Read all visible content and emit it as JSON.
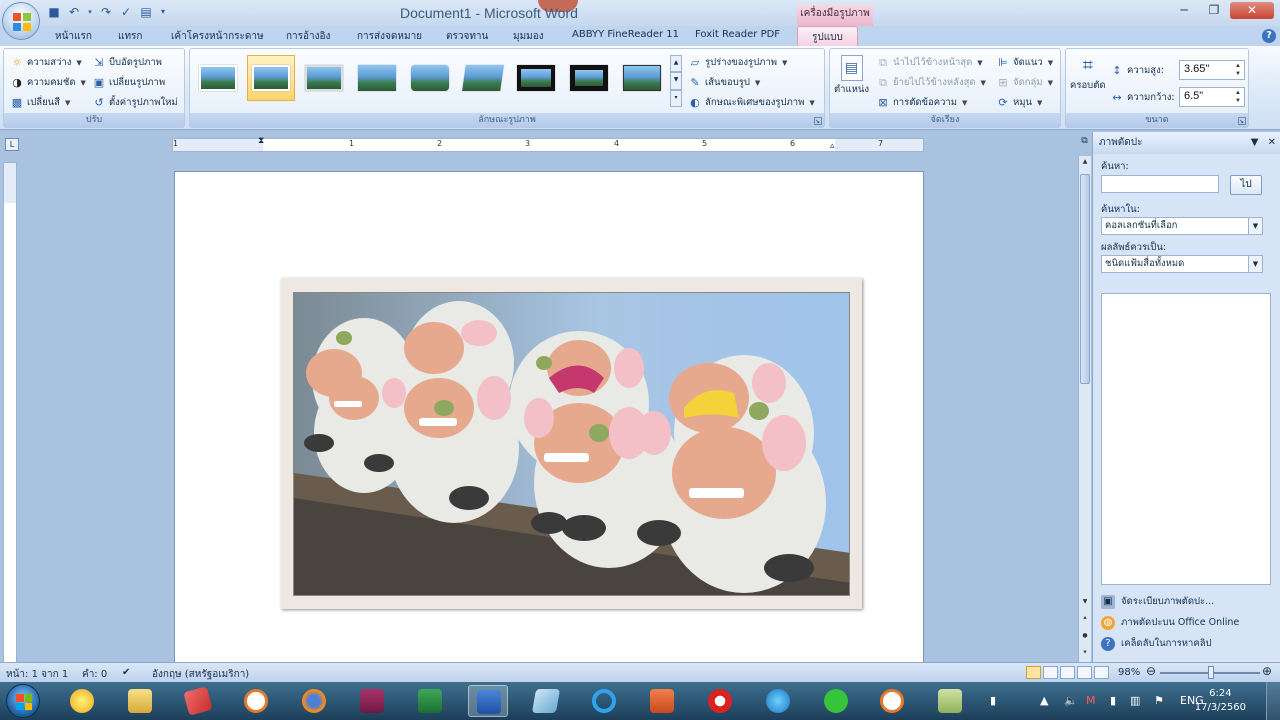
{
  "window": {
    "title": "Document1 - Microsoft Word",
    "context_tab_header": "เครื่องมือรูปภาพ",
    "minimize_label": "─",
    "restore_label": "❐",
    "close_label": "✕"
  },
  "tabs": [
    {
      "label": "หน้าแรก"
    },
    {
      "label": "แทรก"
    },
    {
      "label": "เค้าโครงหน้ากระดาษ"
    },
    {
      "label": "การอ้างอิง"
    },
    {
      "label": "การส่งจดหมาย"
    },
    {
      "label": "ตรวจทาน"
    },
    {
      "label": "มุมมอง"
    },
    {
      "label": "ABBYY FineReader 11"
    },
    {
      "label": "Foxit Reader PDF"
    },
    {
      "label": "รูปแบบ"
    }
  ],
  "ribbon": {
    "adjust": {
      "label": "ปรับ",
      "brightness": "ความสว่าง",
      "contrast": "ความคมชัด",
      "recolor": "เปลี่ยนสี",
      "compress": "บีบอัดรูปภาพ",
      "change_picture": "เปลี่ยนรูปภาพ",
      "reset_picture": "ตั้งค่ารูปภาพใหม่"
    },
    "picture_styles": {
      "label": "ลักษณะรูปภาพ",
      "shape": "รูปร่างของรูปภาพ",
      "border": "เส้นขอบรูป",
      "effects": "ลักษณะพิเศษของรูปภาพ"
    },
    "arrange": {
      "label": "จัดเรียง",
      "position": "ตำแหน่ง",
      "bring_front": "นำไปไว้ข้างหน้าสุด",
      "send_back": "ย้ายไปไว้ข้างหลังสุด",
      "text_wrap": "การตัดข้อความ",
      "align": "จัดแนว",
      "group": "จัดกลุ่ม",
      "rotate": "หมุน"
    },
    "size": {
      "label": "ขนาด",
      "crop": "ครอบตัด",
      "height_label": "ความสูง:",
      "height_value": "3.65\"",
      "width_label": "ความกว้าง:",
      "width_value": "6.5\""
    }
  },
  "ruler": {
    "numbers": [
      "1",
      "1",
      "2",
      "3",
      "4",
      "5",
      "6",
      "7"
    ]
  },
  "task_pane": {
    "title": "ภาพตัดปะ",
    "search_label": "ค้นหา:",
    "go_button": "ไป",
    "search_in_label": "ค้นหาใน:",
    "search_in_value": "คอลเลกชันที่เลือก",
    "results_label": "ผลลัพธ์ควรเป็น:",
    "results_value": "ชนิดแฟ้มสื่อทั้งหมด",
    "link_organize": "จัดระเบียบภาพตัดปะ...",
    "link_online": "ภาพตัดปะบน Office Online",
    "link_tips": "เคล็ดลับในการหาคลิป"
  },
  "status_bar": {
    "page": "หน้า: 1 จาก 1",
    "words": "คำ: 0",
    "language": "อังกฤษ (สหรัฐอเมริกา)",
    "zoom": "98%"
  },
  "taskbar": {
    "language": "ENG",
    "time": "6:24",
    "date": "17/3/2560"
  },
  "colors": {
    "accent": "#3b73c0",
    "context_tab": "#eab6cc",
    "taskbar": "#1c3f5a"
  }
}
